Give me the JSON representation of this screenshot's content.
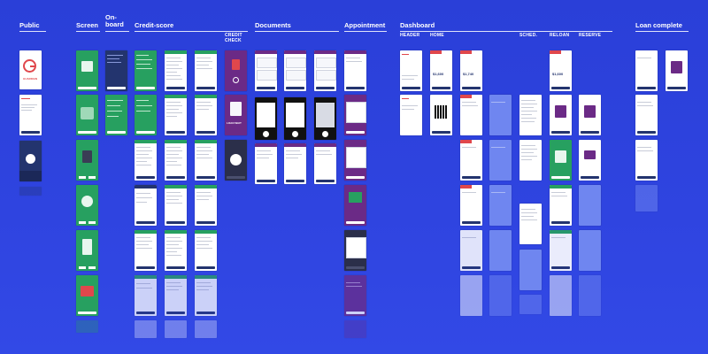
{
  "sections": [
    {
      "id": "public",
      "label": "Public"
    },
    {
      "id": "screen",
      "label": "Screen"
    },
    {
      "id": "onboard",
      "label": "On-\nboard"
    },
    {
      "id": "credit_score",
      "label": "Credit-score"
    },
    {
      "id": "documents",
      "label": "Documents"
    },
    {
      "id": "appointment",
      "label": "Appointment"
    },
    {
      "id": "dashboard",
      "label": "Dashboard"
    },
    {
      "id": "loan_complete",
      "label": "Loan complete"
    }
  ],
  "subheaders": {
    "credit_check": "CREDIT\nCHECK",
    "header": "HEADER",
    "home": "HOME",
    "sched": "SCHED.",
    "reloan": "RELOAN",
    "reserve": "RESERVE"
  },
  "logo_text": "GUARDIAN",
  "amounts": [
    "$1,600",
    "$1,740",
    "$1,600"
  ],
  "cancel_label": "LOAN WAIT",
  "colors": {
    "background": "#2f44e0",
    "green": "#27a060",
    "purple": "#6b2a86",
    "navy": "#23346e",
    "red": "#e0474c",
    "dark": "#2b2f4a",
    "light_blue": "#6f86f0"
  }
}
